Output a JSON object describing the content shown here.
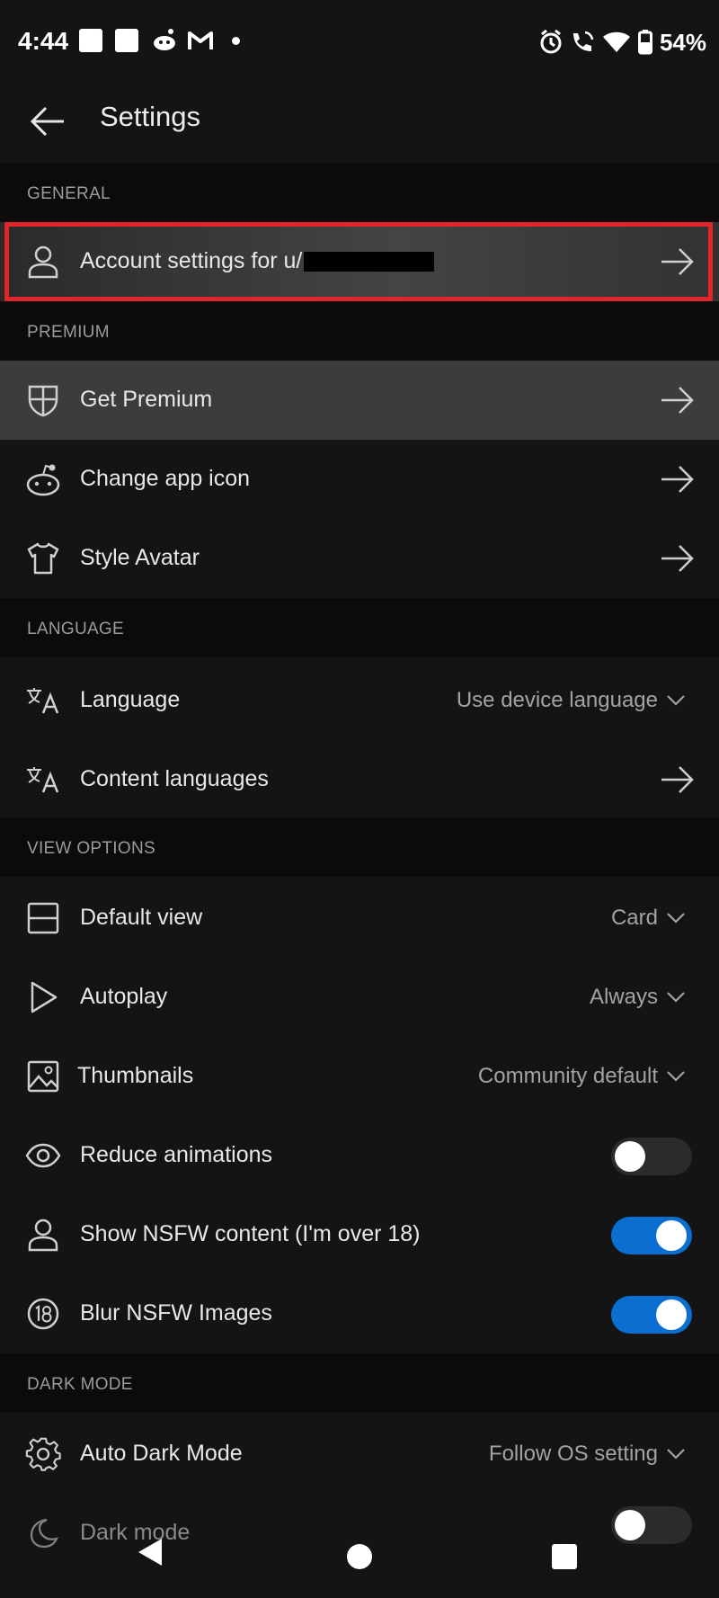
{
  "status": {
    "time": "4:44",
    "battery": "54%"
  },
  "header": {
    "title": "Settings"
  },
  "sections": {
    "general": "GENERAL",
    "premium": "PREMIUM",
    "language": "LANGUAGE",
    "view_options": "VIEW OPTIONS",
    "dark_mode": "DARK MODE"
  },
  "rows": {
    "account": {
      "label": "Account settings for u/"
    },
    "get_premium": {
      "label": "Get Premium"
    },
    "change_icon": {
      "label": "Change app icon"
    },
    "style_avatar": {
      "label": "Style Avatar"
    },
    "language": {
      "label": "Language",
      "value": "Use device language"
    },
    "content_languages": {
      "label": "Content languages"
    },
    "default_view": {
      "label": "Default view",
      "value": "Card"
    },
    "autoplay": {
      "label": "Autoplay",
      "value": "Always"
    },
    "thumbnails": {
      "label": "Thumbnails",
      "value": "Community default"
    },
    "reduce_animations": {
      "label": "Reduce animations",
      "toggle": false
    },
    "show_nsfw": {
      "label": "Show NSFW content (I'm over 18)",
      "toggle": true
    },
    "blur_nsfw": {
      "label": "Blur NSFW Images",
      "toggle": true
    },
    "auto_dark_mode": {
      "label": "Auto Dark Mode",
      "value": "Follow OS setting"
    },
    "dark_mode": {
      "label": "Dark mode",
      "toggle": false
    }
  },
  "icons": {
    "account": "person-icon",
    "premium": "shield-icon",
    "change_icon": "reddit-icon",
    "style_avatar": "shirt-icon",
    "language": "translate-icon",
    "default_view": "layout-icon",
    "autoplay": "play-icon",
    "thumbnails": "image-icon",
    "reduce_animations": "eye-icon",
    "show_nsfw": "person-icon",
    "blur_nsfw": "18-plus-icon",
    "auto_dark_mode": "gear-icon",
    "dark_mode": "moon-icon"
  },
  "colors": {
    "accent": "#0a6fd1",
    "highlight_outline": "#e0252b",
    "background": "#141414"
  }
}
